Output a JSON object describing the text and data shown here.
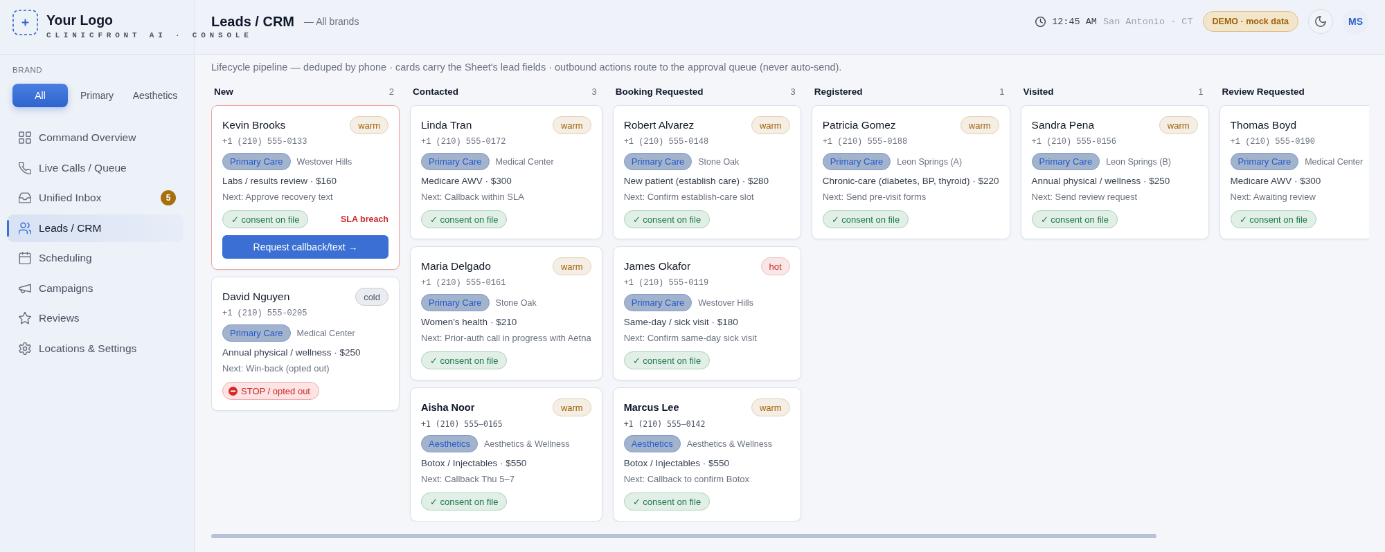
{
  "sidebar": {
    "logo": {
      "title": "Your Logo",
      "subtitle": "CLINICFRONT AI · CONSOLE"
    },
    "brand_label": "BRAND",
    "brand_tabs": [
      {
        "label": "All",
        "selected": true
      },
      {
        "label": "Primary",
        "selected": false
      },
      {
        "label": "Aesthetics",
        "selected": false
      }
    ],
    "nav": [
      {
        "label": "Command Overview",
        "selected": false
      },
      {
        "label": "Live Calls / Queue",
        "selected": false
      },
      {
        "label": "Unified Inbox",
        "selected": false,
        "badge": "5"
      },
      {
        "label": "Leads / CRM",
        "selected": true
      },
      {
        "label": "Scheduling",
        "selected": false
      },
      {
        "label": "Campaigns",
        "selected": false
      },
      {
        "label": "Reviews",
        "selected": false
      },
      {
        "label": "Locations & Settings",
        "selected": false
      }
    ]
  },
  "header": {
    "title": "Leads / CRM",
    "subtitle": "— All brands",
    "time": "12:45 AM",
    "location": "San Antonio · CT",
    "demo_badge": "DEMO · mock data",
    "avatar": "MS"
  },
  "description": "Lifecycle pipeline — deduped by phone · cards carry the Sheet's lead fields · outbound actions route to the approval queue (never auto-send).",
  "columns": [
    {
      "title": "New",
      "count": "2",
      "cards": [
        {
          "kind": "standard",
          "name": "Kevin Brooks",
          "tag": {
            "label": "warm",
            "color": "#a16207"
          },
          "phone": "+1 (210) 555-0133",
          "brand": "Primary Care",
          "location": "Westover Hills",
          "service": "Labs / results review · $160",
          "next": "Next: Approve recovery text",
          "consent": {
            "kind": "on_file",
            "label": "✓ consent on file"
          },
          "sla_breach": true,
          "sla_label": "SLA breach",
          "action": "Request callback/text →"
        },
        {
          "kind": "standard",
          "name": "David Nguyen",
          "tag": {
            "label": "cold",
            "color": "#475569"
          },
          "phone": "+1 (210) 555-0205",
          "brand": "Primary Care",
          "location": "Medical Center",
          "service": "Annual physical / wellness · $250",
          "next": "Next: Win-back (opted out)",
          "consent": {
            "kind": "opted_out",
            "label": "STOP / opted out"
          },
          "sla_breach": false
        }
      ]
    },
    {
      "title": "Contacted",
      "count": "3",
      "cards": [
        {
          "kind": "standard",
          "name": "Linda Tran",
          "tag": {
            "label": "warm",
            "color": "#a16207"
          },
          "phone": "+1 (210) 555-0172",
          "brand": "Primary Care",
          "location": "Medical Center",
          "service": "Medicare AWV · $300",
          "next": "Next: Callback within SLA",
          "consent": {
            "kind": "on_file",
            "label": "✓ consent on file"
          },
          "sla_breach": false
        },
        {
          "kind": "standard",
          "name": "Maria Delgado",
          "tag": {
            "label": "warm",
            "color": "#a16207"
          },
          "phone": "+1 (210) 555-0161",
          "brand": "Primary Care",
          "location": "Stone Oak",
          "service": "Women's health · $210",
          "next": "Next: Prior-auth call in progress with Aetna",
          "consent": {
            "kind": "on_file",
            "label": "✓ consent on file"
          },
          "sla_breach": false
        },
        {
          "kind": "bold",
          "name": "Aisha Noor",
          "tag": {
            "label": "warm",
            "color": "#a16207"
          },
          "phone": "+1 (210) 555–0165",
          "brand": "Aesthetics",
          "location": "Aesthetics & Wellness",
          "service": "Botox / Injectables · $550",
          "next": "Next: Callback Thu 5–7",
          "consent": {
            "kind": "on_file",
            "label": "✓ consent on file"
          },
          "sla_breach": false
        }
      ]
    },
    {
      "title": "Booking Requested",
      "count": "3",
      "cards": [
        {
          "kind": "standard",
          "name": "Robert Alvarez",
          "tag": {
            "label": "warm",
            "color": "#a16207"
          },
          "phone": "+1 (210) 555-0148",
          "brand": "Primary Care",
          "location": "Stone Oak",
          "service": "New patient (establish care) · $280",
          "next": "Next: Confirm establish-care slot",
          "consent": {
            "kind": "on_file",
            "label": "✓ consent on file"
          },
          "sla_breach": false
        },
        {
          "kind": "standard",
          "name": "James Okafor",
          "tag": {
            "label": "hot",
            "color": "#c62828"
          },
          "phone": "+1 (210) 555-0119",
          "brand": "Primary Care",
          "location": "Westover Hills",
          "service": "Same-day / sick visit · $180",
          "next": "Next: Confirm same-day sick visit",
          "consent": {
            "kind": "on_file",
            "label": "✓ consent on file"
          },
          "sla_breach": false
        },
        {
          "kind": "bold",
          "name": "Marcus Lee",
          "tag": {
            "label": "warm",
            "color": "#a16207"
          },
          "phone": "+1 (210) 555–0142",
          "brand": "Aesthetics",
          "location": "Aesthetics & Wellness",
          "service": "Botox / Injectables · $550",
          "next": "Next: Callback to confirm Botox",
          "consent": {
            "kind": "on_file",
            "label": "✓ consent on file"
          },
          "sla_breach": false
        }
      ]
    },
    {
      "title": "Registered",
      "count": "1",
      "cards": [
        {
          "kind": "standard",
          "name": "Patricia Gomez",
          "tag": {
            "label": "warm",
            "color": "#a16207"
          },
          "phone": "+1 (210) 555-0188",
          "brand": "Primary Care",
          "location": "Leon Springs (A)",
          "service": "Chronic-care (diabetes, BP, thyroid) · $220",
          "next": "Next: Send pre-visit forms",
          "consent": {
            "kind": "on_file",
            "label": "✓ consent on file"
          },
          "sla_breach": false
        }
      ]
    },
    {
      "title": "Visited",
      "count": "1",
      "cards": [
        {
          "kind": "standard",
          "name": "Sandra Pena",
          "tag": {
            "label": "warm",
            "color": "#a16207"
          },
          "phone": "+1 (210) 555-0156",
          "brand": "Primary Care",
          "location": "Leon Springs (B)",
          "service": "Annual physical / wellness · $250",
          "next": "Next: Send review request",
          "consent": {
            "kind": "on_file",
            "label": "✓ consent on file"
          },
          "sla_breach": false
        }
      ]
    },
    {
      "title": "Review Requested",
      "cards": [
        {
          "kind": "standard",
          "name": "Thomas Boyd",
          "phone": "+1 (210) 555-0190",
          "brand": "Primary Care",
          "location": "Medical Center",
          "service": "Medicare AWV · $300",
          "next": "Next: Awaiting review",
          "consent": {
            "kind": "on_file",
            "label": "✓ consent on file"
          },
          "sla_breach": false
        }
      ]
    }
  ]
}
